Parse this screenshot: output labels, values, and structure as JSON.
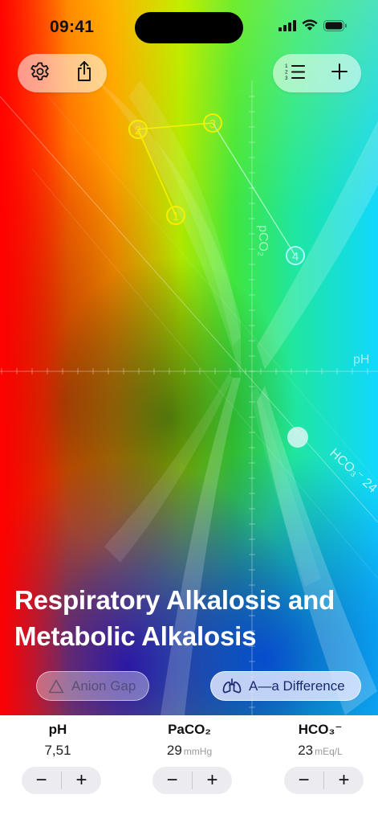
{
  "status_bar": {
    "time": "09:41",
    "icons": [
      "cellular-signal-icon",
      "wifi-icon",
      "battery-icon"
    ]
  },
  "toolbar": {
    "left": [
      "gear-icon",
      "share-icon"
    ],
    "right": [
      "numbered-list-icon",
      "plus-icon"
    ]
  },
  "chart": {
    "axis_labels": {
      "pco2": "pCO₂",
      "ph": "pH",
      "hco3": "HCO₃⁻ 24"
    },
    "points": [
      {
        "label": "1"
      },
      {
        "label": "2"
      },
      {
        "label": "3"
      },
      {
        "label": "4"
      }
    ]
  },
  "diagnosis": {
    "title": "Respiratory Alkalosis and Metabolic Alkalosis"
  },
  "chips": {
    "anion_gap": "Anion Gap",
    "aa_difference": "A—a Difference"
  },
  "params": {
    "ph": {
      "label": "pH",
      "value": "7,51",
      "unit": ""
    },
    "paco2": {
      "label": "PaCO₂",
      "value": "29",
      "unit": "mmHg"
    },
    "hco3": {
      "label": "HCO₃⁻",
      "value": "23",
      "unit": "mEq/L"
    }
  },
  "stepper": {
    "minus": "−",
    "plus": "+"
  },
  "colors": {
    "point_yellow": "#f5f000",
    "point_cyan": "#a8fbff",
    "panel_bg": "#ffffff",
    "chip_text": "#1b2a70"
  }
}
